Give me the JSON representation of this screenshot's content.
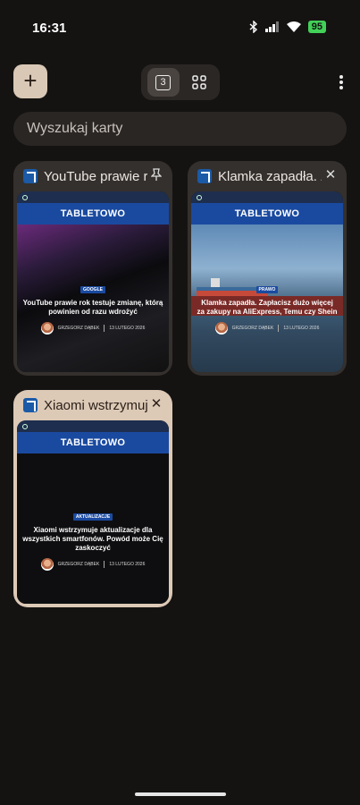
{
  "status_bar": {
    "time": "16:31",
    "battery": "95"
  },
  "toolbar": {
    "new_tab_label": "+",
    "tab_count": "3"
  },
  "search": {
    "placeholder": "Wyszukaj karty"
  },
  "tabs": [
    {
      "title": "YouTube prawie rok testuje zmianę, którą powinien od razu wdrożyć",
      "pinned": true,
      "brand": "TABLETOWO",
      "tag": "GOOGLE",
      "headline": "YouTube prawie rok testuje zmianę, którą powinien od razu wdrożyć",
      "author": "GRZEGORZ DĄBEK",
      "date": "13 LUTEGO 2026"
    },
    {
      "title": "Klamka zapadła. Zapłacisz dużo więcej za zakupy na AliExpress, Temu czy Shein",
      "pinned": false,
      "brand": "TABLETOWO",
      "tag": "PRAWO",
      "headline": "Klamka zapadła. Zapłacisz dużo więcej za zakupy na AliExpress, Temu czy Shein",
      "author": "GRZEGORZ DĄBEK",
      "date": "13 LUTEGO 2026"
    },
    {
      "title": "Xiaomi wstrzymuje aktualizacje dla wszystkich smartfonów",
      "pinned": false,
      "active": true,
      "brand": "TABLETOWO",
      "tag": "AKTUALIZACJE",
      "headline": "Xiaomi wstrzymuje aktualizacje dla wszystkich smartfonów. Powód może Cię zaskoczyć",
      "author": "GRZEGORZ DĄBEK",
      "date": "13 LUTEGO 2026"
    }
  ],
  "icons": {
    "new_tab": "plus-icon",
    "tab_count": "tab-count-icon",
    "tab_groups": "grid-icon",
    "menu": "more-vert-icon",
    "pin": "pin-icon",
    "close": "close-icon"
  },
  "colors": {
    "accent": "#dcc9b6",
    "brand_blue": "#1a4aa0"
  }
}
